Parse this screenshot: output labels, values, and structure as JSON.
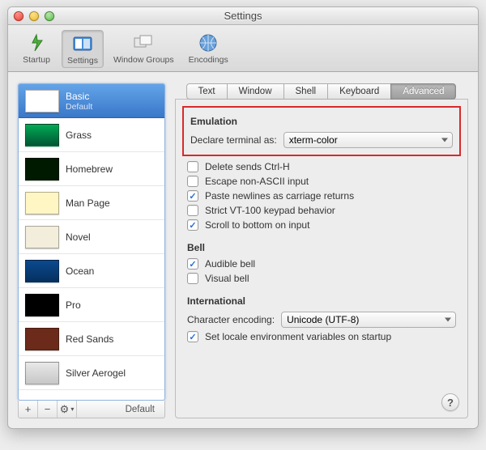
{
  "title": "Settings",
  "toolbar": [
    {
      "name": "startup",
      "label": "Startup"
    },
    {
      "name": "settings",
      "label": "Settings"
    },
    {
      "name": "window-groups",
      "label": "Window Groups"
    },
    {
      "name": "encodings",
      "label": "Encodings"
    }
  ],
  "toolbar_selected": "settings",
  "sidebar": {
    "profiles": [
      {
        "name": "Basic",
        "sub": "Default",
        "thumb": "basic",
        "selected": true
      },
      {
        "name": "Grass",
        "thumb": "grass"
      },
      {
        "name": "Homebrew",
        "thumb": "homebrew"
      },
      {
        "name": "Man Page",
        "thumb": "manpage"
      },
      {
        "name": "Novel",
        "thumb": "novel"
      },
      {
        "name": "Ocean",
        "thumb": "ocean"
      },
      {
        "name": "Pro",
        "thumb": "pro"
      },
      {
        "name": "Red Sands",
        "thumb": "redsands"
      },
      {
        "name": "Silver Aerogel",
        "thumb": "silver"
      }
    ],
    "buttons": {
      "add": "+",
      "remove": "−",
      "action": "⚙︎",
      "default_label": "Default"
    }
  },
  "tabs": [
    "Text",
    "Window",
    "Shell",
    "Keyboard",
    "Advanced"
  ],
  "tab_selected": "Advanced",
  "sections": {
    "emulation": {
      "heading": "Emulation",
      "declare_label": "Declare terminal as:",
      "declare_value": "xterm-color",
      "opts": [
        {
          "label": "Delete sends Ctrl-H",
          "checked": false
        },
        {
          "label": "Escape non-ASCII input",
          "checked": false
        },
        {
          "label": "Paste newlines as carriage returns",
          "checked": true
        },
        {
          "label": "Strict VT-100 keypad behavior",
          "checked": false
        },
        {
          "label": "Scroll to bottom on input",
          "checked": true
        }
      ]
    },
    "bell": {
      "heading": "Bell",
      "opts": [
        {
          "label": "Audible bell",
          "checked": true
        },
        {
          "label": "Visual bell",
          "checked": false
        }
      ]
    },
    "international": {
      "heading": "International",
      "encoding_label": "Character encoding:",
      "encoding_value": "Unicode (UTF-8)",
      "opts": [
        {
          "label": "Set locale environment variables on startup",
          "checked": true
        }
      ]
    }
  },
  "help_label": "?"
}
